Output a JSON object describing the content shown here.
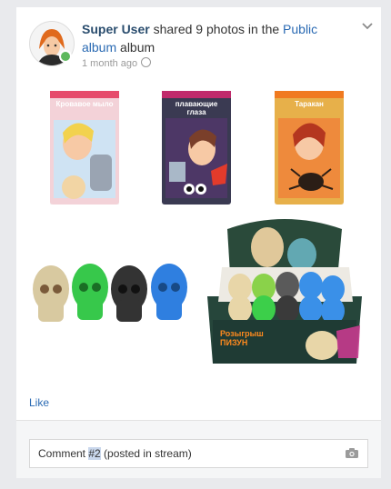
{
  "post": {
    "user_name": "Super User",
    "action_text": " shared 9 photos in the ",
    "album_name": "Public album",
    "album_suffix": " album",
    "time": "1 month ago",
    "privacy_icon": "globe-icon",
    "menu_icon": "chevron-down-icon"
  },
  "photos": [
    {
      "kind": "product-pack",
      "title": "Кровавое мыло",
      "color": "#e64b6b"
    },
    {
      "kind": "product-pack",
      "title": "плавающие глаза",
      "color": "#c02a6b"
    },
    {
      "kind": "product-pack",
      "title": "Таракан",
      "color": "#f07a20"
    },
    {
      "kind": "skull-toys",
      "colors": [
        "#d8c9a0",
        "#37c84b",
        "#333333",
        "#2f7fe0"
      ]
    },
    {
      "kind": "display-box",
      "box_text": "Розыгрыш ПИЗУН"
    }
  ],
  "actions": {
    "like_label": "Like"
  },
  "comment": {
    "before": "Comment ",
    "highlight": "#2",
    "after": " (posted in stream)",
    "attach_icon": "camera-icon"
  },
  "colors": {
    "link": "#2a6ab3",
    "username": "#2a4d6e",
    "online": "#5cb85c"
  }
}
